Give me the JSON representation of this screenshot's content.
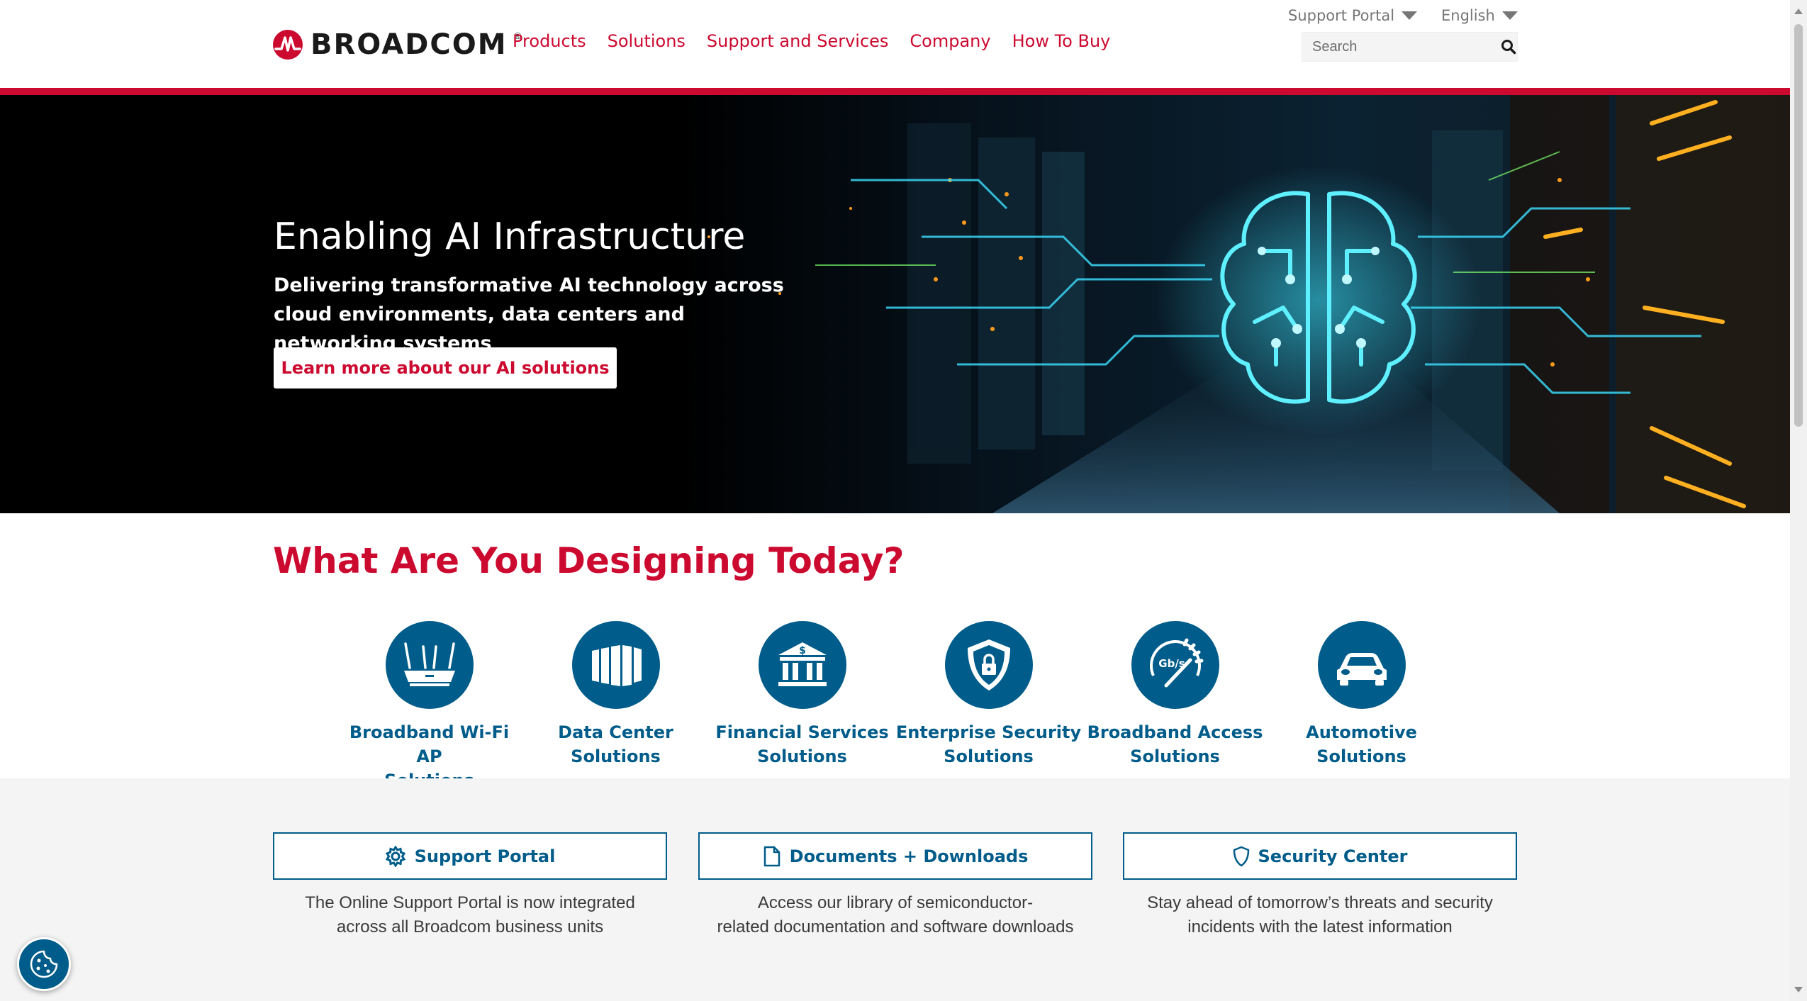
{
  "header": {
    "logo_text": "BROADCOM",
    "logo_reg": "®",
    "nav": [
      "Products",
      "Solutions",
      "Support and Services",
      "Company",
      "How To Buy"
    ],
    "support_portal_label": "Support Portal",
    "language_label": "English",
    "search_placeholder": "Search"
  },
  "hero": {
    "title": "Enabling AI Infrastructure",
    "subtitle": "Delivering transformative AI technology across cloud environments, data centers and networking systems",
    "button_label": "Learn more about our AI solutions"
  },
  "designing": {
    "title": "What Are You Designing Today?",
    "items": [
      {
        "line1": "Broadband Wi-Fi AP",
        "line2": "Solutions",
        "icon": "wifi-router-icon"
      },
      {
        "line1": "Data Center",
        "line2": "Solutions",
        "icon": "server-rack-icon"
      },
      {
        "line1": "Financial Services",
        "line2": "Solutions",
        "icon": "bank-icon"
      },
      {
        "line1": "Enterprise Security",
        "line2": "Solutions",
        "icon": "shield-lock-icon"
      },
      {
        "line1": "Broadband Access",
        "line2": "Solutions",
        "icon": "speedometer-icon"
      },
      {
        "line1": "Automotive",
        "line2": "Solutions",
        "icon": "car-icon"
      }
    ],
    "speed_label": "Gb/s"
  },
  "cards": [
    {
      "label": "Support Portal",
      "desc_line1": "The Online Support Portal is now integrated",
      "desc_line2": "across all Broadcom business units",
      "icon": "gear-icon"
    },
    {
      "label": "Documents + Downloads",
      "desc_line1": "Access our library of semiconductor-",
      "desc_line2": "related documentation and software downloads",
      "icon": "document-icon"
    },
    {
      "label": "Security Center",
      "desc_line1": "Stay ahead of tomorrow’s threats and security",
      "desc_line2": "incidents with the latest information",
      "icon": "shield-icon"
    }
  ],
  "colors": {
    "brand_red": "#cc092f",
    "brand_blue": "#005c8a",
    "band_grey": "#f4f4f4"
  }
}
